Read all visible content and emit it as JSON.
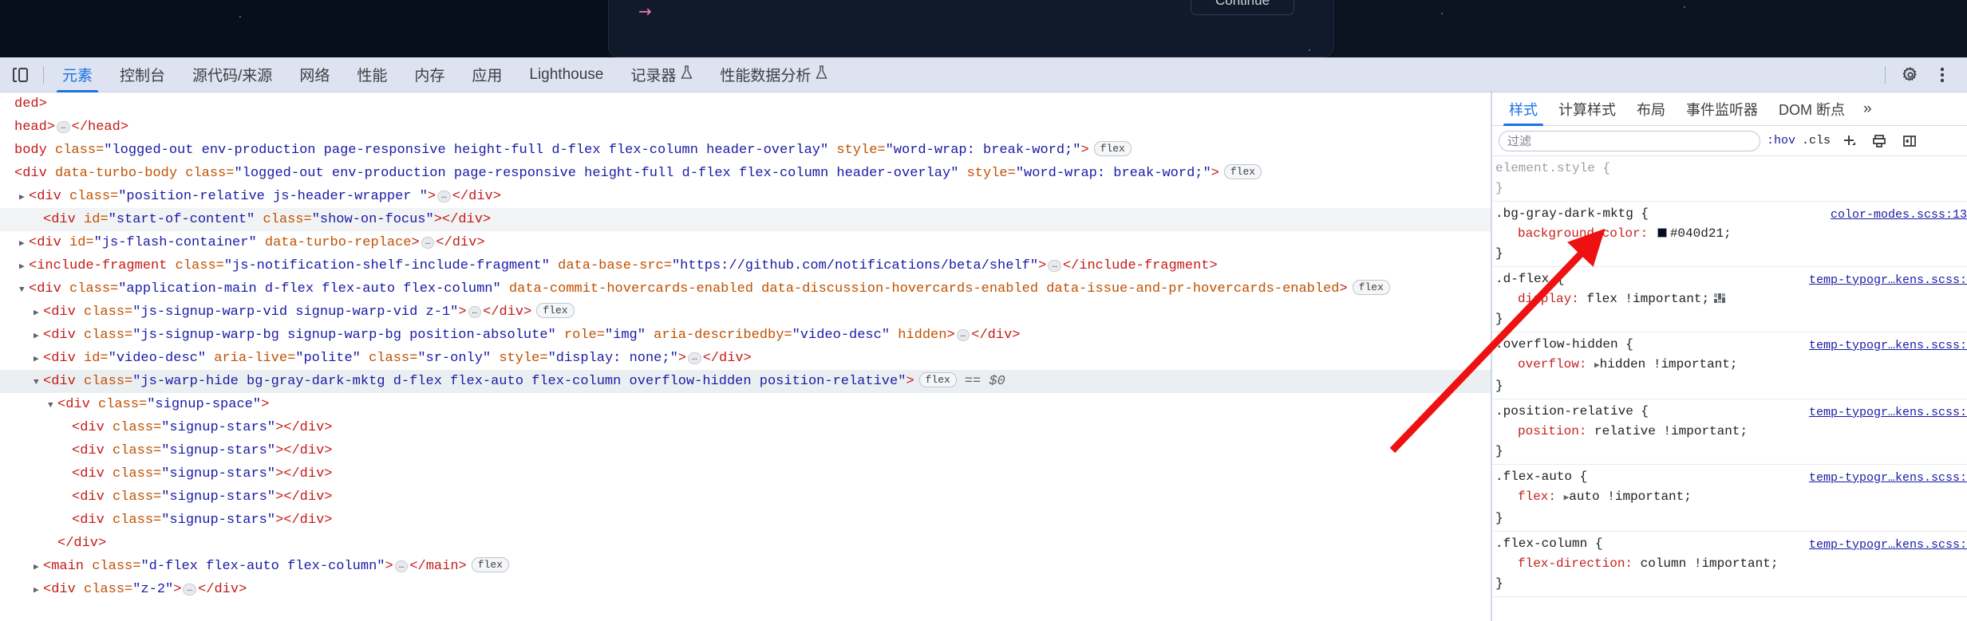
{
  "inspected_page": {
    "arrow_glyph": "→",
    "continue_button": "Continue"
  },
  "devtools": {
    "toolbar": {
      "inspect_icon": "inspect-element-icon",
      "device_icon": "device-toolbar-icon",
      "settings_icon": "gear-icon",
      "more_icon": "more-options-icon"
    },
    "tabs": [
      {
        "label": "元素",
        "selected": true,
        "flask": ""
      },
      {
        "label": "控制台",
        "selected": false,
        "flask": ""
      },
      {
        "label": "源代码/来源",
        "selected": false,
        "flask": ""
      },
      {
        "label": "网络",
        "selected": false,
        "flask": ""
      },
      {
        "label": "性能",
        "selected": false,
        "flask": ""
      },
      {
        "label": "内存",
        "selected": false,
        "flask": ""
      },
      {
        "label": "应用",
        "selected": false,
        "flask": ""
      },
      {
        "label": "Lighthouse",
        "selected": false,
        "flask": ""
      },
      {
        "label": "记录器",
        "selected": false,
        "flask": "⚗"
      },
      {
        "label": "性能数据分析",
        "selected": false,
        "flask": "⚗"
      }
    ]
  },
  "dom_tree": {
    "rows": [
      {
        "indent": 0,
        "twisty": "",
        "highlight": "",
        "parts": [
          {
            "t": "tg",
            "v": "ded>"
          }
        ]
      },
      {
        "indent": 0,
        "twisty": "",
        "highlight": "",
        "parts": [
          {
            "t": "tg",
            "v": "head>"
          },
          {
            "t": "ell",
            "v": "…"
          },
          {
            "t": "tg",
            "v": "</head>"
          }
        ]
      },
      {
        "indent": 0,
        "twisty": "",
        "highlight": "",
        "parts": [
          {
            "t": "tg",
            "v": "body "
          },
          {
            "t": "at",
            "v": "class="
          },
          {
            "t": "av",
            "v": "\"logged-out env-production page-responsive height-full d-flex flex-column header-overlay\""
          },
          {
            "t": "at",
            "v": " style="
          },
          {
            "t": "av",
            "v": "\"word-wrap: break-word;\""
          },
          {
            "t": "tg",
            "v": ">"
          },
          {
            "t": "badge",
            "v": "flex"
          }
        ]
      },
      {
        "indent": 0,
        "twisty": "",
        "highlight": "",
        "parts": [
          {
            "t": "tg",
            "v": "<div "
          },
          {
            "t": "at",
            "v": "data-turbo-body class="
          },
          {
            "t": "av",
            "v": "\"logged-out env-production page-responsive height-full d-flex flex-column header-overlay\""
          },
          {
            "t": "at",
            "v": " style="
          },
          {
            "t": "av",
            "v": "\"word-wrap: break-word;\""
          },
          {
            "t": "tg",
            "v": ">"
          },
          {
            "t": "badge",
            "v": "flex"
          }
        ]
      },
      {
        "indent": 1,
        "twisty": "▶",
        "highlight": "",
        "parts": [
          {
            "t": "tg",
            "v": "<div "
          },
          {
            "t": "at",
            "v": "class="
          },
          {
            "t": "av",
            "v": "\"position-relative js-header-wrapper \""
          },
          {
            "t": "tg",
            "v": ">"
          },
          {
            "t": "ell",
            "v": "…"
          },
          {
            "t": "tg",
            "v": "</div>"
          }
        ]
      },
      {
        "indent": 2,
        "twisty": "",
        "highlight": "hl-gray",
        "parts": [
          {
            "t": "tg",
            "v": "<div "
          },
          {
            "t": "at",
            "v": "id="
          },
          {
            "t": "av",
            "v": "\"start-of-content\""
          },
          {
            "t": "at",
            "v": " class="
          },
          {
            "t": "av",
            "v": "\"show-on-focus\""
          },
          {
            "t": "tg",
            "v": "></div>"
          }
        ]
      },
      {
        "indent": 1,
        "twisty": "▶",
        "highlight": "",
        "parts": [
          {
            "t": "tg",
            "v": "<div "
          },
          {
            "t": "at",
            "v": "id="
          },
          {
            "t": "av",
            "v": "\"js-flash-container\""
          },
          {
            "t": "at",
            "v": " data-turbo-replace"
          },
          {
            "t": "tg",
            "v": ">"
          },
          {
            "t": "ell",
            "v": "…"
          },
          {
            "t": "tg",
            "v": "</div>"
          }
        ]
      },
      {
        "indent": 1,
        "twisty": "▶",
        "highlight": "",
        "parts": [
          {
            "t": "tg",
            "v": "<include-fragment "
          },
          {
            "t": "at",
            "v": "class="
          },
          {
            "t": "av",
            "v": "\"js-notification-shelf-include-fragment\""
          },
          {
            "t": "at",
            "v": " data-base-src="
          },
          {
            "t": "av",
            "v": "\"https://github.com/notifications/beta/shelf\""
          },
          {
            "t": "tg",
            "v": ">"
          },
          {
            "t": "ell",
            "v": "…"
          },
          {
            "t": "tg",
            "v": "</include-fragment>"
          }
        ]
      },
      {
        "indent": 1,
        "twisty": "▼",
        "highlight": "",
        "parts": [
          {
            "t": "tg",
            "v": "<div "
          },
          {
            "t": "at",
            "v": "class="
          },
          {
            "t": "av",
            "v": "\"application-main d-flex flex-auto flex-column\""
          },
          {
            "t": "at",
            "v": " data-commit-hovercards-enabled data-discussion-hovercards-enabled data-issue-and-pr-hovercards-enabled"
          },
          {
            "t": "tg",
            "v": ">"
          },
          {
            "t": "badge",
            "v": "flex"
          }
        ]
      },
      {
        "indent": 2,
        "twisty": "▶",
        "highlight": "",
        "parts": [
          {
            "t": "tg",
            "v": "<div "
          },
          {
            "t": "at",
            "v": "class="
          },
          {
            "t": "av",
            "v": "\"js-signup-warp-vid signup-warp-vid z-1\""
          },
          {
            "t": "tg",
            "v": ">"
          },
          {
            "t": "ell",
            "v": "…"
          },
          {
            "t": "tg",
            "v": "</div>"
          },
          {
            "t": "badge",
            "v": "flex"
          }
        ]
      },
      {
        "indent": 2,
        "twisty": "▶",
        "highlight": "",
        "parts": [
          {
            "t": "tg",
            "v": "<div "
          },
          {
            "t": "at",
            "v": "class="
          },
          {
            "t": "av",
            "v": "\"js-signup-warp-bg signup-warp-bg position-absolute\""
          },
          {
            "t": "at",
            "v": " role="
          },
          {
            "t": "av",
            "v": "\"img\""
          },
          {
            "t": "at",
            "v": " aria-describedby="
          },
          {
            "t": "av",
            "v": "\"video-desc\""
          },
          {
            "t": "at",
            "v": " hidden"
          },
          {
            "t": "tg",
            "v": ">"
          },
          {
            "t": "ell",
            "v": "…"
          },
          {
            "t": "tg",
            "v": "</div>"
          }
        ]
      },
      {
        "indent": 2,
        "twisty": "▶",
        "highlight": "",
        "parts": [
          {
            "t": "tg",
            "v": "<div "
          },
          {
            "t": "at",
            "v": "id="
          },
          {
            "t": "av",
            "v": "\"video-desc\""
          },
          {
            "t": "at",
            "v": " aria-live="
          },
          {
            "t": "av",
            "v": "\"polite\""
          },
          {
            "t": "at",
            "v": " class="
          },
          {
            "t": "av",
            "v": "\"sr-only\""
          },
          {
            "t": "at",
            "v": " style="
          },
          {
            "t": "av",
            "v": "\"display: none;\""
          },
          {
            "t": "tg",
            "v": ">"
          },
          {
            "t": "ell",
            "v": "…"
          },
          {
            "t": "tg",
            "v": "</div>"
          }
        ]
      },
      {
        "indent": 2,
        "twisty": "▼",
        "highlight": "hl-sel",
        "parts": [
          {
            "t": "tg",
            "v": "<div "
          },
          {
            "t": "at",
            "v": "class="
          },
          {
            "t": "av",
            "v": "\"js-warp-hide bg-gray-dark-mktg d-flex flex-auto flex-column overflow-hidden position-relative\""
          },
          {
            "t": "tg",
            "v": ">"
          },
          {
            "t": "badge",
            "v": "flex"
          },
          {
            "t": "eq0",
            "v": "== $0"
          }
        ]
      },
      {
        "indent": 3,
        "twisty": "▼",
        "highlight": "",
        "parts": [
          {
            "t": "tg",
            "v": "<div "
          },
          {
            "t": "at",
            "v": "class="
          },
          {
            "t": "av",
            "v": "\"signup-space\""
          },
          {
            "t": "tg",
            "v": ">"
          }
        ]
      },
      {
        "indent": 4,
        "twisty": "",
        "highlight": "",
        "parts": [
          {
            "t": "tg",
            "v": "<div "
          },
          {
            "t": "at",
            "v": "class="
          },
          {
            "t": "av",
            "v": "\"signup-stars\""
          },
          {
            "t": "tg",
            "v": "></div>"
          }
        ]
      },
      {
        "indent": 4,
        "twisty": "",
        "highlight": "",
        "parts": [
          {
            "t": "tg",
            "v": "<div "
          },
          {
            "t": "at",
            "v": "class="
          },
          {
            "t": "av",
            "v": "\"signup-stars\""
          },
          {
            "t": "tg",
            "v": "></div>"
          }
        ]
      },
      {
        "indent": 4,
        "twisty": "",
        "highlight": "",
        "parts": [
          {
            "t": "tg",
            "v": "<div "
          },
          {
            "t": "at",
            "v": "class="
          },
          {
            "t": "av",
            "v": "\"signup-stars\""
          },
          {
            "t": "tg",
            "v": "></div>"
          }
        ]
      },
      {
        "indent": 4,
        "twisty": "",
        "highlight": "",
        "parts": [
          {
            "t": "tg",
            "v": "<div "
          },
          {
            "t": "at",
            "v": "class="
          },
          {
            "t": "av",
            "v": "\"signup-stars\""
          },
          {
            "t": "tg",
            "v": "></div>"
          }
        ]
      },
      {
        "indent": 4,
        "twisty": "",
        "highlight": "",
        "parts": [
          {
            "t": "tg",
            "v": "<div "
          },
          {
            "t": "at",
            "v": "class="
          },
          {
            "t": "av",
            "v": "\"signup-stars\""
          },
          {
            "t": "tg",
            "v": "></div>"
          }
        ]
      },
      {
        "indent": 3,
        "twisty": "",
        "highlight": "",
        "parts": [
          {
            "t": "tg",
            "v": "</div>"
          }
        ]
      },
      {
        "indent": 2,
        "twisty": "▶",
        "highlight": "",
        "parts": [
          {
            "t": "tg",
            "v": "<main "
          },
          {
            "t": "at",
            "v": "class="
          },
          {
            "t": "av",
            "v": "\"d-flex flex-auto flex-column\""
          },
          {
            "t": "tg",
            "v": ">"
          },
          {
            "t": "ell",
            "v": "…"
          },
          {
            "t": "tg",
            "v": "</main>"
          },
          {
            "t": "badge",
            "v": "flex"
          }
        ]
      },
      {
        "indent": 2,
        "twisty": "▶",
        "highlight": "",
        "parts": [
          {
            "t": "tg",
            "v": "<div "
          },
          {
            "t": "at",
            "v": "class="
          },
          {
            "t": "av",
            "v": "\"z-2\""
          },
          {
            "t": "tg",
            "v": ">"
          },
          {
            "t": "ell",
            "v": "…"
          },
          {
            "t": "tg",
            "v": "</div>"
          }
        ]
      }
    ]
  },
  "styles_panel": {
    "tabs": [
      {
        "label": "样式",
        "selected": true
      },
      {
        "label": "计算样式",
        "selected": false
      },
      {
        "label": "布局",
        "selected": false
      },
      {
        "label": "事件监听器",
        "selected": false
      },
      {
        "label": "DOM 断点",
        "selected": false
      }
    ],
    "more_label": "»",
    "toolbar": {
      "filter_placeholder": "过滤",
      "hov_label": ":hov",
      "cls_label": ".cls",
      "new_rule_icon": "add-style-rule-icon",
      "print_icon": "print-preview-icon",
      "sidebar_icon": "toggle-sidebar-icon"
    },
    "rules": [
      {
        "selector": "element.style {",
        "source": "",
        "dim": true,
        "declarations": [],
        "close": "}"
      },
      {
        "selector": ".bg-gray-dark-mktg {",
        "source": "color-modes.scss:13",
        "dim": false,
        "declarations": [
          {
            "prop": "background-color:",
            "value": "#040d21;",
            "swatch": "#040d21",
            "triangle": false,
            "grid_icon": false
          }
        ],
        "close": "}"
      },
      {
        "selector": ".d-flex {",
        "source": "temp-typogr…kens.scss:",
        "dim": false,
        "declarations": [
          {
            "prop": "display:",
            "value": "flex !important;",
            "swatch": "",
            "triangle": false,
            "grid_icon": true
          }
        ],
        "close": "}"
      },
      {
        "selector": ".overflow-hidden {",
        "source": "temp-typogr…kens.scss:",
        "dim": false,
        "declarations": [
          {
            "prop": "overflow:",
            "value": "hidden !important;",
            "swatch": "",
            "triangle": true,
            "grid_icon": false
          }
        ],
        "close": "}"
      },
      {
        "selector": ".position-relative {",
        "source": "temp-typogr…kens.scss:",
        "dim": false,
        "declarations": [
          {
            "prop": "position:",
            "value": "relative !important;",
            "swatch": "",
            "triangle": false,
            "grid_icon": false
          }
        ],
        "close": "}"
      },
      {
        "selector": ".flex-auto {",
        "source": "temp-typogr…kens.scss:",
        "dim": false,
        "declarations": [
          {
            "prop": "flex:",
            "value": "auto !important;",
            "swatch": "",
            "triangle": true,
            "grid_icon": false
          }
        ],
        "close": "}"
      },
      {
        "selector": ".flex-column {",
        "source": "temp-typogr…kens.scss:",
        "dim": false,
        "declarations": [
          {
            "prop": "flex-direction:",
            "value": "column !important;",
            "swatch": "",
            "triangle": false,
            "grid_icon": false
          }
        ],
        "close": "}"
      }
    ]
  },
  "annotation": {
    "arrow_color": "#ee1111",
    "arrow_name": "red-pointer-arrow"
  }
}
